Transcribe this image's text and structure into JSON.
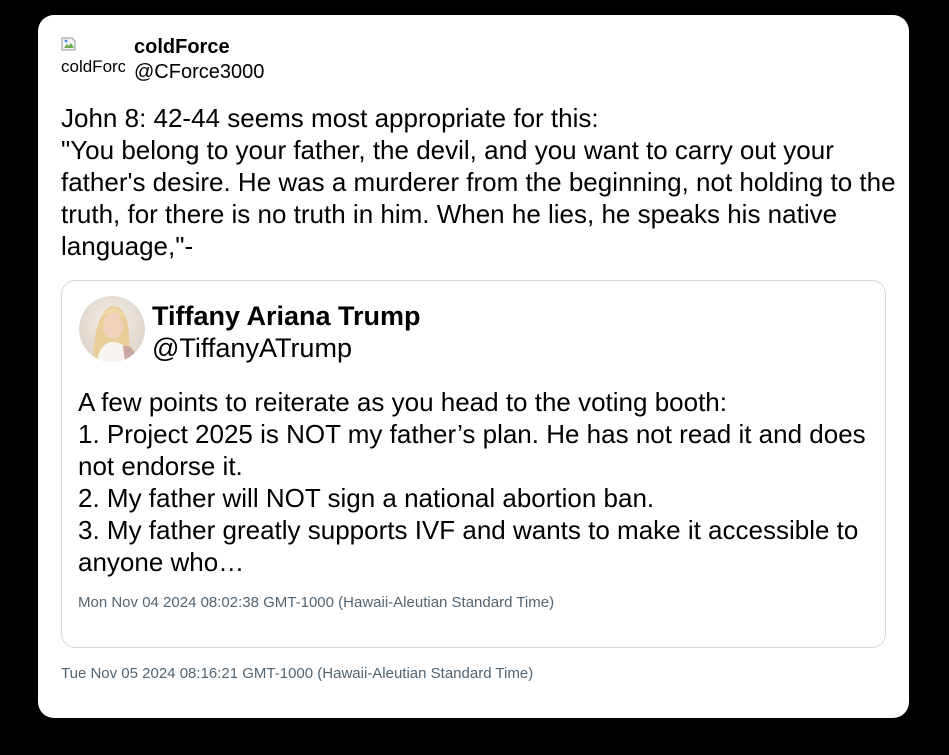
{
  "tweet": {
    "author": {
      "name": "coldForce",
      "handle": "@CForce3000",
      "avatar_alt": "coldForce"
    },
    "text": "John 8: 42-44 seems most appropriate for this:\n\"You belong to your father, the devil, and you want to carry out your father's desire. He was a murderer from the beginning, not holding to the truth, for there is no truth in him. When he lies, he speaks his native language,\"-",
    "timestamp": "Tue Nov 05 2024 08:16:21 GMT-1000 (Hawaii-Aleutian Standard Time)",
    "quoted": {
      "author": {
        "name": "Tiffany Ariana Trump",
        "handle": "@TiffanyATrump"
      },
      "text": "A few points to reiterate as you head to the voting booth:\n1. Project 2025 is NOT my father’s plan. He has not read it and does not endorse it.\n2. My father will NOT sign a national abortion ban.\n3. My father greatly supports IVF and wants to make it accessible to anyone who…",
      "timestamp": "Mon Nov 04 2024 08:02:38 GMT-1000 (Hawaii-Aleutian Standard Time)"
    }
  },
  "colors": {
    "background": "#000000",
    "card": "#ffffff",
    "border": "#cfd9de",
    "muted_text": "#536471"
  }
}
